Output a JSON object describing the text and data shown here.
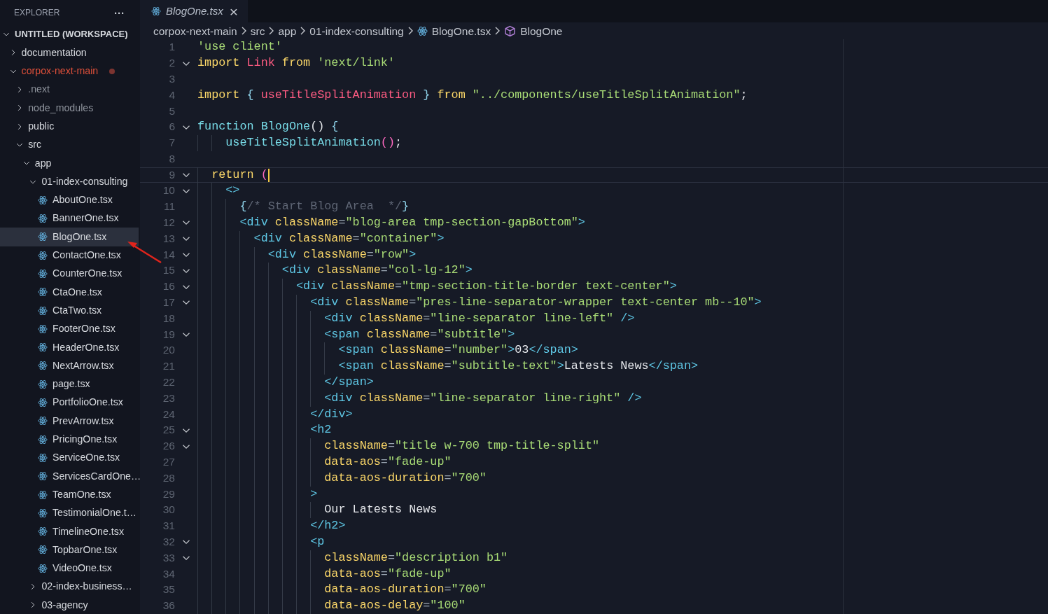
{
  "explorer": {
    "title": "EXPLORER",
    "more_label": "···",
    "workspace": {
      "title": "UNTITLED (WORKSPACE)",
      "expanded": true,
      "children": [
        {
          "kind": "folder",
          "name": "documentation",
          "expanded": false,
          "selected": false
        },
        {
          "kind": "folder",
          "name": "corpox-next-main",
          "expanded": true,
          "selected": false,
          "modified": true,
          "children": [
            {
              "kind": "folder",
              "name": ".next",
              "expanded": false,
              "selected": false,
              "ignored": true
            },
            {
              "kind": "folder",
              "name": "node_modules",
              "expanded": false,
              "selected": false,
              "ignored": true
            },
            {
              "kind": "folder",
              "name": "public",
              "expanded": false,
              "selected": false
            },
            {
              "kind": "folder",
              "name": "src",
              "expanded": true,
              "selected": false,
              "children": [
                {
                  "kind": "folder",
                  "name": "app",
                  "expanded": true,
                  "selected": false,
                  "children": [
                    {
                      "kind": "folder",
                      "name": "01-index-consulting",
                      "expanded": true,
                      "selected": false,
                      "children": [
                        {
                          "kind": "file",
                          "name": "AboutOne.tsx",
                          "selected": false
                        },
                        {
                          "kind": "file",
                          "name": "BannerOne.tsx",
                          "selected": false
                        },
                        {
                          "kind": "file",
                          "name": "BlogOne.tsx",
                          "selected": true
                        },
                        {
                          "kind": "file",
                          "name": "ContactOne.tsx",
                          "selected": false
                        },
                        {
                          "kind": "file",
                          "name": "CounterOne.tsx",
                          "selected": false
                        },
                        {
                          "kind": "file",
                          "name": "CtaOne.tsx",
                          "selected": false
                        },
                        {
                          "kind": "file",
                          "name": "CtaTwo.tsx",
                          "selected": false
                        },
                        {
                          "kind": "file",
                          "name": "FooterOne.tsx",
                          "selected": false
                        },
                        {
                          "kind": "file",
                          "name": "HeaderOne.tsx",
                          "selected": false
                        },
                        {
                          "kind": "file",
                          "name": "NextArrow.tsx",
                          "selected": false
                        },
                        {
                          "kind": "file",
                          "name": "page.tsx",
                          "selected": false
                        },
                        {
                          "kind": "file",
                          "name": "PortfolioOne.tsx",
                          "selected": false
                        },
                        {
                          "kind": "file",
                          "name": "PrevArrow.tsx",
                          "selected": false
                        },
                        {
                          "kind": "file",
                          "name": "PricingOne.tsx",
                          "selected": false
                        },
                        {
                          "kind": "file",
                          "name": "ServiceOne.tsx",
                          "selected": false
                        },
                        {
                          "kind": "file",
                          "name": "ServicesCardOne…",
                          "selected": false
                        },
                        {
                          "kind": "file",
                          "name": "TeamOne.tsx",
                          "selected": false
                        },
                        {
                          "kind": "file",
                          "name": "TestimonialOne.t…",
                          "selected": false
                        },
                        {
                          "kind": "file",
                          "name": "TimelineOne.tsx",
                          "selected": false
                        },
                        {
                          "kind": "file",
                          "name": "TopbarOne.tsx",
                          "selected": false
                        },
                        {
                          "kind": "file",
                          "name": "VideoOne.tsx",
                          "selected": false
                        }
                      ]
                    },
                    {
                      "kind": "folder",
                      "name": "02-index-business…",
                      "expanded": false,
                      "selected": false
                    },
                    {
                      "kind": "folder",
                      "name": "03-agency",
                      "expanded": false,
                      "selected": false
                    }
                  ]
                }
              ]
            }
          ]
        }
      ]
    }
  },
  "tabs": [
    {
      "label": "BlogOne.tsx",
      "selected": true,
      "preview": true,
      "close_label": "×"
    }
  ],
  "breadcrumbs": [
    {
      "kind": "folder",
      "text": "corpox-next-main"
    },
    {
      "kind": "folder",
      "text": "src"
    },
    {
      "kind": "folder",
      "text": "app"
    },
    {
      "kind": "folder",
      "text": "01-index-consulting"
    },
    {
      "kind": "file",
      "text": "BlogOne.tsx"
    },
    {
      "kind": "symbol",
      "text": "BlogOne"
    }
  ],
  "editor": {
    "lines": [
      {
        "number": "1",
        "foldable": false,
        "tokens": [
          {
            "kind": "str",
            "text": "'use client'"
          }
        ]
      },
      {
        "number": "2",
        "foldable": true,
        "tokens": [
          {
            "kind": "kw",
            "text": "import "
          },
          {
            "kind": "var",
            "text": "Link "
          },
          {
            "kind": "kw",
            "text": "from "
          },
          {
            "kind": "str",
            "text": "'next/link'"
          }
        ]
      },
      {
        "number": "3",
        "foldable": false
      },
      {
        "number": "4",
        "foldable": false,
        "tokens": [
          {
            "kind": "kw",
            "text": "import "
          },
          {
            "kind": "brace",
            "text": "{ "
          },
          {
            "kind": "var",
            "text": "useTitleSplitAnimation "
          },
          {
            "kind": "brace",
            "text": "} "
          },
          {
            "kind": "kw",
            "text": "from "
          },
          {
            "kind": "str",
            "text": "\"../components/useTitleSplitAnimation\""
          },
          {
            "kind": "text",
            "text": ";"
          }
        ]
      },
      {
        "number": "5",
        "foldable": false
      },
      {
        "number": "6",
        "foldable": true,
        "tokens": [
          {
            "kind": "fn",
            "text": "function "
          },
          {
            "kind": "fn",
            "text": "BlogOne"
          },
          {
            "kind": "text",
            "text": "() "
          },
          {
            "kind": "brace",
            "text": "{"
          }
        ]
      },
      {
        "number": "7",
        "foldable": false,
        "tokens": [
          {
            "kind": "fn",
            "text": "    useTitleSplitAnimation"
          },
          {
            "kind": "bracket",
            "text": "()"
          },
          {
            "kind": "text",
            "text": ";"
          }
        ]
      },
      {
        "number": "8",
        "foldable": false
      },
      {
        "number": "9",
        "foldable": true,
        "current": true,
        "tokens": [
          {
            "kind": "kw",
            "text": "  return "
          },
          {
            "kind": "bracket",
            "text": "("
          }
        ]
      },
      {
        "number": "10",
        "foldable": true,
        "tokens": [
          {
            "kind": "tag",
            "text": "    <>"
          }
        ]
      },
      {
        "number": "11",
        "foldable": false,
        "tokens": [
          {
            "kind": "brace",
            "text": "      {"
          },
          {
            "kind": "comment",
            "text": "/* Start Blog Area  */"
          },
          {
            "kind": "brace",
            "text": "}"
          }
        ]
      },
      {
        "number": "12",
        "foldable": true,
        "tokens": [
          {
            "kind": "tag",
            "text": "      <div "
          },
          {
            "kind": "attr",
            "text": "className"
          },
          {
            "kind": "punct",
            "text": "="
          },
          {
            "kind": "str",
            "text": "\"blog-area tmp-section-gapBottom\""
          },
          {
            "kind": "tag",
            "text": ">"
          }
        ]
      },
      {
        "number": "13",
        "foldable": true,
        "tokens": [
          {
            "kind": "tag",
            "text": "        <div "
          },
          {
            "kind": "attr",
            "text": "className"
          },
          {
            "kind": "punct",
            "text": "="
          },
          {
            "kind": "str",
            "text": "\"container\""
          },
          {
            "kind": "tag",
            "text": ">"
          }
        ]
      },
      {
        "number": "14",
        "foldable": true,
        "tokens": [
          {
            "kind": "tag",
            "text": "          <div "
          },
          {
            "kind": "attr",
            "text": "className"
          },
          {
            "kind": "punct",
            "text": "="
          },
          {
            "kind": "str",
            "text": "\"row\""
          },
          {
            "kind": "tag",
            "text": ">"
          }
        ]
      },
      {
        "number": "15",
        "foldable": true,
        "tokens": [
          {
            "kind": "tag",
            "text": "            <div "
          },
          {
            "kind": "attr",
            "text": "className"
          },
          {
            "kind": "punct",
            "text": "="
          },
          {
            "kind": "str",
            "text": "\"col-lg-12\""
          },
          {
            "kind": "tag",
            "text": ">"
          }
        ]
      },
      {
        "number": "16",
        "foldable": true,
        "tokens": [
          {
            "kind": "tag",
            "text": "              <div "
          },
          {
            "kind": "attr",
            "text": "className"
          },
          {
            "kind": "punct",
            "text": "="
          },
          {
            "kind": "str",
            "text": "\"tmp-section-title-border text-center\""
          },
          {
            "kind": "tag",
            "text": ">"
          }
        ]
      },
      {
        "number": "17",
        "foldable": true,
        "tokens": [
          {
            "kind": "tag",
            "text": "                <div "
          },
          {
            "kind": "attr",
            "text": "className"
          },
          {
            "kind": "punct",
            "text": "="
          },
          {
            "kind": "str",
            "text": "\"pres-line-separator-wrapper text-center mb--10\""
          },
          {
            "kind": "tag",
            "text": ">"
          }
        ]
      },
      {
        "number": "18",
        "foldable": false,
        "tokens": [
          {
            "kind": "tag",
            "text": "                  <div "
          },
          {
            "kind": "attr",
            "text": "className"
          },
          {
            "kind": "punct",
            "text": "="
          },
          {
            "kind": "str",
            "text": "\"line-separator line-left\""
          },
          {
            "kind": "tag",
            "text": " />"
          }
        ]
      },
      {
        "number": "19",
        "foldable": true,
        "tokens": [
          {
            "kind": "tag",
            "text": "                  <span "
          },
          {
            "kind": "attr",
            "text": "className"
          },
          {
            "kind": "punct",
            "text": "="
          },
          {
            "kind": "str",
            "text": "\"subtitle\""
          },
          {
            "kind": "tag",
            "text": ">"
          }
        ]
      },
      {
        "number": "20",
        "foldable": false,
        "tokens": [
          {
            "kind": "tag",
            "text": "                    <span "
          },
          {
            "kind": "attr",
            "text": "className"
          },
          {
            "kind": "punct",
            "text": "="
          },
          {
            "kind": "str",
            "text": "\"number\""
          },
          {
            "kind": "tag",
            "text": ">"
          },
          {
            "kind": "text",
            "text": "03"
          },
          {
            "kind": "tag",
            "text": "</span>"
          }
        ]
      },
      {
        "number": "21",
        "foldable": false,
        "tokens": [
          {
            "kind": "tag",
            "text": "                    <span "
          },
          {
            "kind": "attr",
            "text": "className"
          },
          {
            "kind": "punct",
            "text": "="
          },
          {
            "kind": "str",
            "text": "\"subtitle-text\""
          },
          {
            "kind": "tag",
            "text": ">"
          },
          {
            "kind": "text",
            "text": "Latests News"
          },
          {
            "kind": "tag",
            "text": "</span>"
          }
        ]
      },
      {
        "number": "22",
        "foldable": false,
        "tokens": [
          {
            "kind": "tag",
            "text": "                  </span>"
          }
        ]
      },
      {
        "number": "23",
        "foldable": false,
        "tokens": [
          {
            "kind": "tag",
            "text": "                  <div "
          },
          {
            "kind": "attr",
            "text": "className"
          },
          {
            "kind": "punct",
            "text": "="
          },
          {
            "kind": "str",
            "text": "\"line-separator line-right\""
          },
          {
            "kind": "tag",
            "text": " />"
          }
        ]
      },
      {
        "number": "24",
        "foldable": false,
        "tokens": [
          {
            "kind": "tag",
            "text": "                </div>"
          }
        ]
      },
      {
        "number": "25",
        "foldable": true,
        "tokens": [
          {
            "kind": "tag",
            "text": "                <h2"
          }
        ]
      },
      {
        "number": "26",
        "foldable": true,
        "tokens": [
          {
            "kind": "attr",
            "text": "                  className"
          },
          {
            "kind": "punct",
            "text": "="
          },
          {
            "kind": "str",
            "text": "\"title w-700 tmp-title-split\""
          }
        ]
      },
      {
        "number": "27",
        "foldable": false,
        "tokens": [
          {
            "kind": "attr",
            "text": "                  data-aos"
          },
          {
            "kind": "punct",
            "text": "="
          },
          {
            "kind": "str",
            "text": "\"fade-up\""
          }
        ]
      },
      {
        "number": "28",
        "foldable": false,
        "tokens": [
          {
            "kind": "attr",
            "text": "                  data-aos-duration"
          },
          {
            "kind": "punct",
            "text": "="
          },
          {
            "kind": "str",
            "text": "\"700\""
          }
        ]
      },
      {
        "number": "29",
        "foldable": false,
        "tokens": [
          {
            "kind": "tag",
            "text": "                >"
          }
        ]
      },
      {
        "number": "30",
        "foldable": false,
        "tokens": [
          {
            "kind": "text",
            "text": "                  Our Latests News"
          }
        ]
      },
      {
        "number": "31",
        "foldable": false,
        "tokens": [
          {
            "kind": "tag",
            "text": "                </h2>"
          }
        ]
      },
      {
        "number": "32",
        "foldable": true,
        "tokens": [
          {
            "kind": "tag",
            "text": "                <p"
          }
        ]
      },
      {
        "number": "33",
        "foldable": true,
        "tokens": [
          {
            "kind": "attr",
            "text": "                  className"
          },
          {
            "kind": "punct",
            "text": "="
          },
          {
            "kind": "str",
            "text": "\"description b1\""
          }
        ]
      },
      {
        "number": "34",
        "foldable": false,
        "tokens": [
          {
            "kind": "attr",
            "text": "                  data-aos"
          },
          {
            "kind": "punct",
            "text": "="
          },
          {
            "kind": "str",
            "text": "\"fade-up\""
          }
        ]
      },
      {
        "number": "35",
        "foldable": false,
        "tokens": [
          {
            "kind": "attr",
            "text": "                  data-aos-duration"
          },
          {
            "kind": "punct",
            "text": "="
          },
          {
            "kind": "str",
            "text": "\"700\""
          }
        ]
      },
      {
        "number": "36",
        "foldable": false,
        "tokens": [
          {
            "kind": "attr",
            "text": "                  data-aos-delay"
          },
          {
            "kind": "punct",
            "text": "="
          },
          {
            "kind": "str",
            "text": "\"100\""
          }
        ]
      }
    ]
  }
}
